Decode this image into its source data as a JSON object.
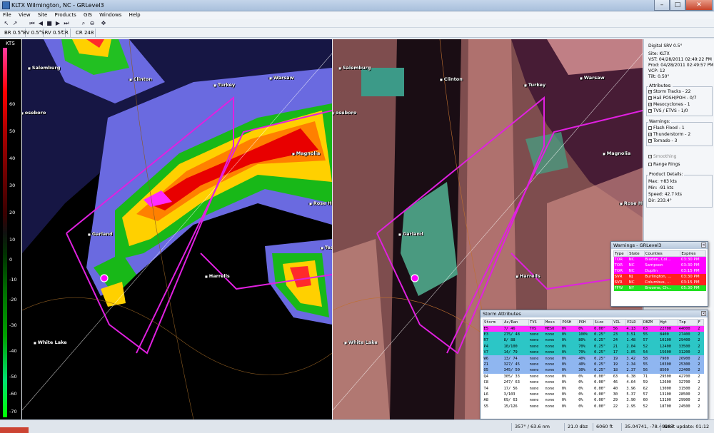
{
  "window": {
    "title": "KLTX Wilmington, NC - GRLevel3"
  },
  "menu": [
    "File",
    "View",
    "Site",
    "Products",
    "GIS",
    "Windows",
    "Help"
  ],
  "products": [
    "BR 0.5°",
    "BV 0.5°",
    "SRV 0.5°",
    "CR",
    "CR 248"
  ],
  "legend": {
    "unit": "KTS",
    "ticks": [
      "60",
      "50",
      "40",
      "30",
      "20",
      "10",
      "0",
      "-10",
      "-20",
      "-30",
      "-40",
      "-50",
      "-60",
      "-70"
    ]
  },
  "cities_left": [
    {
      "name": "Salemburg"
    },
    {
      "name": "Clinton"
    },
    {
      "name": "Turkey"
    },
    {
      "name": "Warsaw"
    },
    {
      "name": "oseboro"
    },
    {
      "name": "Magnolia"
    },
    {
      "name": "Rose Hill"
    },
    {
      "name": "Garland"
    },
    {
      "name": "Harrells"
    },
    {
      "name": "Tea"
    },
    {
      "name": "White Lake"
    }
  ],
  "cities_right": [
    {
      "name": "Salemburg"
    },
    {
      "name": "Clinton"
    },
    {
      "name": "Turkey"
    },
    {
      "name": "Warsaw"
    },
    {
      "name": "oseboro"
    },
    {
      "name": "Magnolia"
    },
    {
      "name": "Rose Hill"
    },
    {
      "name": "Garland"
    },
    {
      "name": "Harrells"
    },
    {
      "name": "White Lake"
    }
  ],
  "side": {
    "product": "Digital SRV 0.5°",
    "site": "Site:  KLTX",
    "vst": "VST:  04/28/2011  02:49:22 PM",
    "prod": "Prod: 04/28/2011  02:49:57 PM",
    "vcp": "VCP:  12",
    "tilt": "Tilt:  0.50°",
    "attributes_title": "Attributes:",
    "attributes": [
      "Storm Tracks - 22",
      "Hail POSH/POH - 0/7",
      "Mesocyclones - 1",
      "TVS / ETVS - 1/0"
    ],
    "warnings_title": "Warnings:",
    "warnings": [
      "Flash Flood - 1",
      "Thunderstorm - 2",
      "Tornado - 3"
    ],
    "smoothing": "Smoothing",
    "range_rings": "Range Rings",
    "details_title": "Product Details:",
    "details": [
      "Max:    +83 kts",
      "Min:     -91 kts",
      "Speed:  42.7 kts",
      "Dir:     233.4°"
    ]
  },
  "warnings_window": {
    "title": "Warnings - GRLevel3",
    "headers": [
      "Type",
      "State",
      "Counties",
      "Expires"
    ],
    "rows": [
      {
        "type": "TOR",
        "state": "NC",
        "counties": "Bladen, Col...",
        "expires": "03:30 PM",
        "color": "#ff00ff"
      },
      {
        "type": "TOR",
        "state": "NC",
        "counties": "Sampson",
        "expires": "03:30 PM",
        "color": "#ff00ff"
      },
      {
        "type": "TOR",
        "state": "NC",
        "counties": "Duplin",
        "expires": "03:15 PM",
        "color": "#ff00ff"
      },
      {
        "type": "SVR",
        "state": "NJ",
        "counties": "Burlington, ...",
        "expires": "03:30 PM",
        "color": "#ff2020"
      },
      {
        "type": "SVR",
        "state": "NC",
        "counties": "Columbus, ...",
        "expires": "03:15 PM",
        "color": "#ff2020"
      },
      {
        "type": "FFW",
        "state": "NY",
        "counties": "Broome, Ch...",
        "expires": "05:30 PM",
        "color": "#20e020"
      }
    ]
  },
  "storm_window": {
    "title": "Storm Attributes",
    "headers": [
      "Storm",
      "Az/Ran",
      "TVS",
      "Meso",
      "POSH",
      "POH",
      "Size",
      "VIL",
      "VILD",
      "DBZM",
      "Hgt",
      "Top",
      "F"
    ],
    "rows": [
      {
        "c": [
          "E5",
          "7/ 46",
          "TVS",
          "MESO",
          "0%",
          "0%",
          "0.00\"",
          "56",
          "4.13",
          "63",
          "22700",
          "44000",
          "2"
        ],
        "bg": "#ff30ff"
      },
      {
        "c": [
          "E3",
          "275/ 48",
          "none",
          "none",
          "0%",
          "100%",
          "0.25\"",
          "23",
          "3.51",
          "55",
          "8400",
          "27400",
          "2"
        ],
        "bg": "#2cc6c6"
      },
      {
        "c": [
          "R7",
          "8/ 88",
          "none",
          "none",
          "0%",
          "80%",
          "0.25\"",
          "24",
          "1.48",
          "57",
          "10100",
          "29400",
          "2"
        ],
        "bg": "#2cc6c6"
      },
      {
        "c": [
          "P4",
          "10/100",
          "none",
          "none",
          "0%",
          "70%",
          "0.25\"",
          "21",
          "2.04",
          "52",
          "12400",
          "33500",
          "2"
        ],
        "bg": "#2cc6c6"
      },
      {
        "c": [
          "V7",
          "14/ 79",
          "none",
          "none",
          "0%",
          "70%",
          "0.25\"",
          "17",
          "1.05",
          "54",
          "15600",
          "31200",
          "2"
        ],
        "bg": "#2cc6c6"
      },
      {
        "c": [
          "W6",
          "13/ 74",
          "none",
          "none",
          "0%",
          "40%",
          "0.25\"",
          "19",
          "3.42",
          "58",
          "7900",
          "26900",
          "2"
        ],
        "bg": "#8fb6f0"
      },
      {
        "c": [
          "Z1",
          "327/ 45",
          "none",
          "none",
          "0%",
          "40%",
          "0.25\"",
          "19",
          "2.34",
          "55",
          "10300",
          "25300",
          "2"
        ],
        "bg": "#8fb6f0"
      },
      {
        "c": [
          "O5",
          "345/ 50",
          "none",
          "none",
          "0%",
          "30%",
          "0.25\"",
          "18",
          "2.37",
          "56",
          "8500",
          "22400",
          "2"
        ],
        "bg": "#8fb6f0"
      },
      {
        "c": [
          "Q4",
          "305/ 33",
          "none",
          "none",
          "0%",
          "0%",
          "0.00\"",
          "63",
          "6.38",
          "71",
          "29500",
          "42700",
          "2"
        ],
        "bg": "#ffffff"
      },
      {
        "c": [
          "C8",
          "247/ 63",
          "none",
          "none",
          "0%",
          "0%",
          "0.00\"",
          "46",
          "4.64",
          "59",
          "12600",
          "32700",
          "2"
        ],
        "bg": "#ffffff"
      },
      {
        "c": [
          "T4",
          "17/ 56",
          "none",
          "none",
          "0%",
          "0%",
          "0.00\"",
          "40",
          "3.96",
          "62",
          "13000",
          "31500",
          "2"
        ],
        "bg": "#ffffff"
      },
      {
        "c": [
          "L6",
          "3/103",
          "none",
          "none",
          "0%",
          "0%",
          "0.00\"",
          "30",
          "5.37",
          "57",
          "13100",
          "28500",
          "2"
        ],
        "bg": "#ffffff"
      },
      {
        "c": [
          "A8",
          "69/ 63",
          "none",
          "none",
          "0%",
          "0%",
          "0.00\"",
          "29",
          "3.90",
          "60",
          "13100",
          "29900",
          "2"
        ],
        "bg": "#ffffff"
      },
      {
        "c": [
          "S5",
          "15/126",
          "none",
          "none",
          "0%",
          "0%",
          "0.00\"",
          "22",
          "2.95",
          "52",
          "18700",
          "24500",
          "2"
        ],
        "bg": "#ffffff"
      }
    ]
  },
  "status": {
    "azran": "357° / 63.6 nm",
    "dbz": "21.0 dbz",
    "height": "6060 ft",
    "coords": "35.04741, -78.49287",
    "update": "Next update: 01:12"
  }
}
